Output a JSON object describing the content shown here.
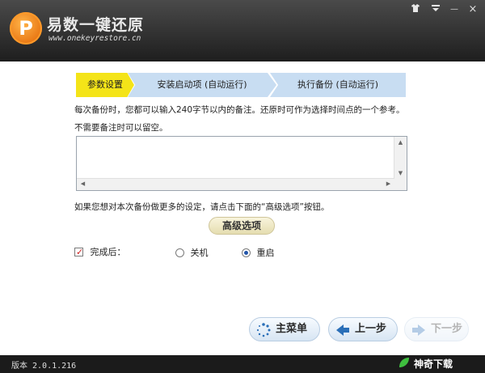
{
  "app": {
    "title": "易数一键还原",
    "url": "www.onekeyrestore.cn"
  },
  "window_controls": {
    "shirt_icon": "shirt-icon",
    "menu_icon": "menu-down-icon",
    "minimize_label": "—",
    "close_label": "×"
  },
  "steps": [
    {
      "label": "参数设置",
      "active": true
    },
    {
      "label": "安装启动项 (自动运行)",
      "active": false
    },
    {
      "label": "执行备份 (自动运行)",
      "active": false
    }
  ],
  "instructions": {
    "line1": "每次备份时，您都可以输入240字节以内的备注。还原时可作为选择时间点的一个参考。",
    "line2": "不需要备注时可以留空。",
    "line3": "如果您想对本次备份做更多的设定，请点击下面的“高级选项”按钮。"
  },
  "memo": {
    "value": ""
  },
  "advanced_button": "高级选项",
  "after_completion": {
    "label": "完成后：",
    "checked": true,
    "options": [
      "关机",
      "重启"
    ],
    "selected": "重启"
  },
  "nav": {
    "main_menu": "主菜单",
    "prev": "上一步",
    "next": "下一步"
  },
  "footer": {
    "version": "版本 2.0.1.216",
    "watermark": "神奇下载"
  },
  "colors": {
    "active_step": "#f4e418",
    "inactive_step": "#c8ddf2",
    "title_bar": "#2f2f2f"
  }
}
